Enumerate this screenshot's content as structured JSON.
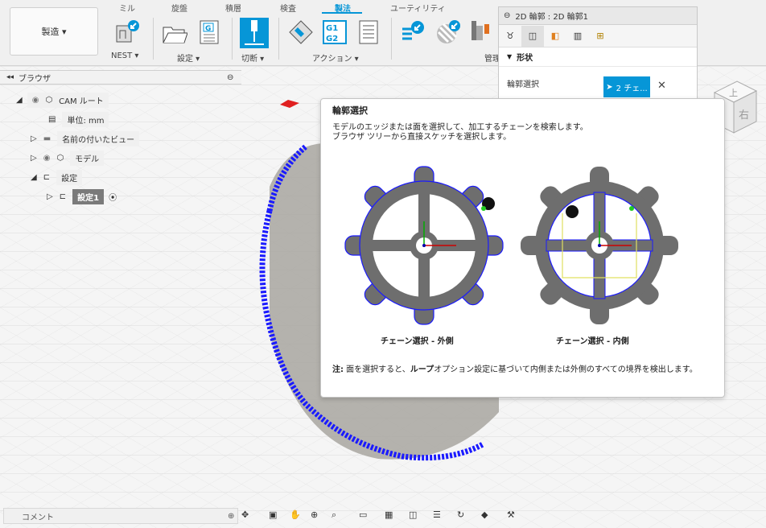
{
  "ribbon": {
    "tabs": [
      "ミル",
      "旋盤",
      "積層",
      "検査",
      "製法",
      "ユーティリティ"
    ],
    "active_tab": "製法",
    "workspace_label": "製造 ▾",
    "groups": {
      "nest": "NEST ▾",
      "setup": "設定 ▾",
      "cut": "切断 ▾",
      "action": "アクション ▾",
      "manage": "管理"
    }
  },
  "panel": {
    "title": "2D 輪郭 : 2D 輪郭1",
    "section_title": "形状",
    "contour_label": "輪郭選択",
    "chain_button": "2 チェ..."
  },
  "browser": {
    "title": "ブラウザ",
    "items": [
      {
        "label": "CAM ルート"
      },
      {
        "label": "単位: mm"
      },
      {
        "label": "名前の付いたビュー"
      },
      {
        "label": "モデル"
      },
      {
        "label": "設定"
      },
      {
        "label": "設定1"
      }
    ]
  },
  "tooltip": {
    "title": "輪郭選択",
    "desc_line1": "モデルのエッジまたは面を選択して、加工するチェーンを検索します。",
    "desc_line2": "ブラウザ ツリーから直接スケッチを選択します。",
    "caption_outside": "チェーン選択 - 外側",
    "caption_inside": "チェーン選択 - 内側",
    "note_bold": "注:",
    "note_text": " 面を選択すると、",
    "note_bold2": "ループ",
    "note_text2": "オプション設定に基づいて内側または外側のすべての境界を検出します。"
  },
  "viewcube": {
    "top_label": "上",
    "right_label": "右"
  },
  "statusbar": {
    "comment_label": "コメント"
  },
  "colors": {
    "accent": "#0696d7",
    "chain_blue": "#1a1aff",
    "gear_gray": "#6e6e6e"
  }
}
